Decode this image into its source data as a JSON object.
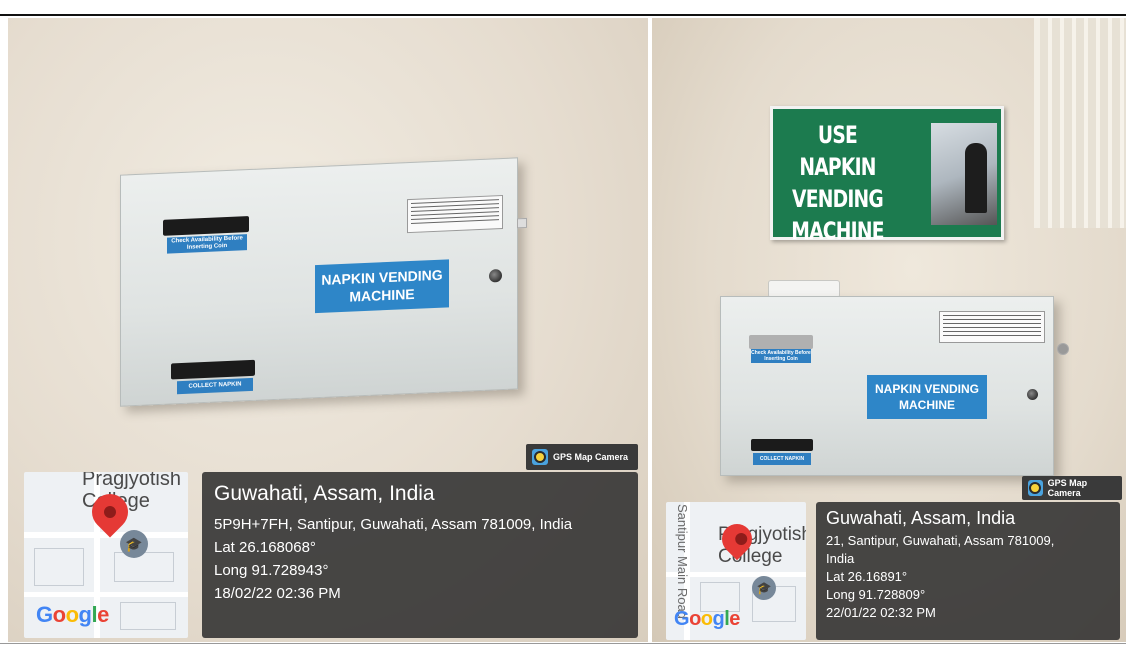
{
  "left_photo": {
    "machine": {
      "sticker_text": "NAPKIN VENDING\nMACHINE",
      "top_label": "Check Availability Before Inserting Coin",
      "bottom_label": "COLLECT NAPKIN"
    },
    "gps": {
      "badge": "GPS Map Camera",
      "map_place": "Pragjyotish\nCollege",
      "map_logo": "Google",
      "title": "Guwahati, Assam, India",
      "address": "5P9H+7FH, Santipur, Guwahati, Assam 781009, India",
      "lat": "Lat 26.168068°",
      "long": "Long 91.728943°",
      "datetime": "18/02/22 02:36 PM"
    }
  },
  "right_photo": {
    "sign": {
      "text": "USE NAPKIN\nVENDING MACHINE"
    },
    "machine": {
      "sticker_text": "NAPKIN VENDING\nMACHINE",
      "top_label": "Check Availability Before Inserting Coin",
      "bottom_label": "COLLECT NAPKIN"
    },
    "gps": {
      "badge": "GPS Map Camera",
      "map_place": "Pragjyotish\nCollege",
      "map_road": "Santipur Main Road",
      "map_logo": "Google",
      "title": "Guwahati, Assam, India",
      "address_line1": "21, Santipur, Guwahati, Assam 781009,",
      "address_line2": "India",
      "lat": "Lat 26.16891°",
      "long": "Long 91.728809°",
      "datetime": "22/01/22 02:32 PM"
    }
  },
  "colors": {
    "sticker_blue": "#2e86c8",
    "sign_green": "#1c7b4f",
    "overlay_dark": "#303030",
    "pin_red": "#e53935"
  }
}
